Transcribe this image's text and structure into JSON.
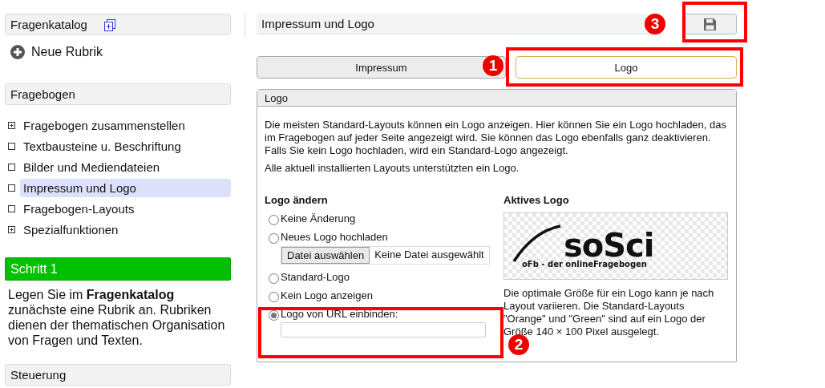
{
  "sidebar": {
    "catalog": {
      "title": "Fragenkatalog"
    },
    "new_rubric": "Neue Rubrik",
    "questionnaire": {
      "title": "Fragebogen",
      "items": [
        {
          "label": "Fragebogen zusammenstellen",
          "expandable": true,
          "selected": false
        },
        {
          "label": "Textbausteine u. Beschriftung",
          "expandable": false,
          "selected": false
        },
        {
          "label": "Bilder und Mediendateien",
          "expandable": false,
          "selected": false
        },
        {
          "label": "Impressum und Logo",
          "expandable": false,
          "selected": true
        },
        {
          "label": "Fragebogen-Layouts",
          "expandable": false,
          "selected": false
        },
        {
          "label": "Spezialfunktionen",
          "expandable": true,
          "selected": false
        }
      ]
    },
    "step": {
      "title": "Schritt 1",
      "text": "Legen Sie im **Fragenkatalog** zunächste eine Rubrik an. Rubriken dienen der thematischen Organisation von Fragen und Texten."
    },
    "control": {
      "title": "Steuerung"
    }
  },
  "main": {
    "title": "Impressum und Logo",
    "tabs": [
      {
        "label": "Impressum",
        "selected": false
      },
      {
        "label": "Logo",
        "selected": true
      }
    ],
    "panel": {
      "title": "Logo",
      "paragraphs": [
        "Die meisten Standard-Layouts können ein Logo anzeigen. Hier können Sie ein Logo hochladen, das im Fragebogen auf jeder Seite angezeigt wird. Sie können das Logo ebenfalls ganz deaktivieren. Falls Sie kein Logo hochladen, wird ein Standard-Logo angezeigt.",
        "Alle aktuell installierten Layouts unterstützten ein Logo."
      ],
      "change": {
        "heading": "Logo ändern",
        "options": [
          {
            "kind": "plain",
            "label": "Keine Änderung",
            "selected": false
          },
          {
            "kind": "file",
            "label": "Neues Logo hochladen",
            "selected": false,
            "button": "Datei auswählen",
            "status": "Keine Datei ausgewählt"
          },
          {
            "kind": "plain",
            "label": "Standard-Logo",
            "selected": false
          },
          {
            "kind": "plain",
            "label": "Kein Logo anzeigen",
            "selected": false
          },
          {
            "kind": "url",
            "label": "Logo von URL einbinden:",
            "selected": true
          }
        ]
      },
      "active": {
        "heading": "Aktives Logo",
        "logo": {
          "wordmark": "soSci",
          "tagline": "oFb - der onlineFragebogen"
        },
        "note": "Die optimale Größe für ein Logo kann je nach Layout variieren. Die Standard-Layouts \"Orange\" und \"Green\" sind auf ein Logo der Größe 140 × 100 Pixel ausgelegt."
      }
    }
  },
  "annotations": [
    {
      "number": "1"
    },
    {
      "number": "2"
    },
    {
      "number": "3"
    }
  ]
}
